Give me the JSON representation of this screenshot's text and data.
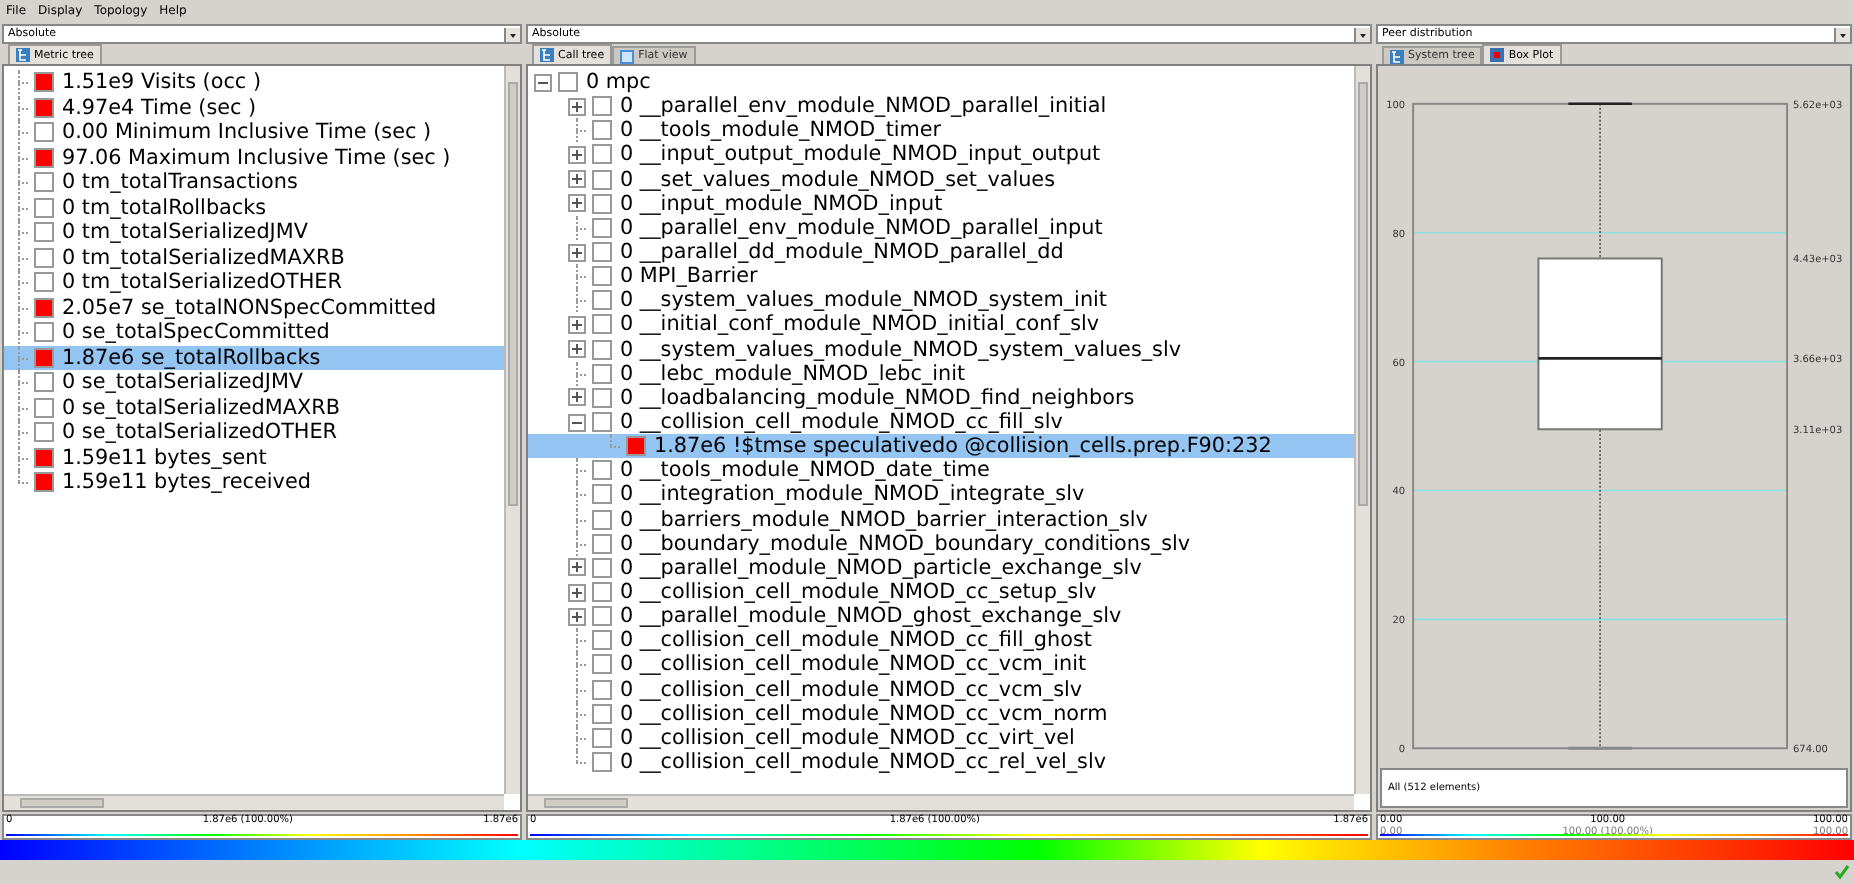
{
  "menu": [
    "File",
    "Display",
    "Topology",
    "Help"
  ],
  "metric_panel": {
    "mode": "Absolute",
    "tabs": [
      {
        "label": "Metric tree",
        "kind": "tree",
        "selected": true
      }
    ],
    "items": [
      {
        "label": "1.51e9 Visits (occ )",
        "color": "#ff0000",
        "selected": false
      },
      {
        "label": "4.97e4 Time (sec )",
        "color": "#ff0000",
        "selected": false
      },
      {
        "label": "0.00 Minimum Inclusive Time (sec )",
        "color": "#ffffff",
        "selected": false
      },
      {
        "label": "97.06 Maximum Inclusive Time (sec )",
        "color": "#ff0000",
        "selected": false
      },
      {
        "label": "0 tm_totalTransactions",
        "color": "#ffffff",
        "selected": false
      },
      {
        "label": "0 tm_totalRollbacks",
        "color": "#ffffff",
        "selected": false
      },
      {
        "label": "0 tm_totalSerializedJMV",
        "color": "#ffffff",
        "selected": false
      },
      {
        "label": "0 tm_totalSerializedMAXRB",
        "color": "#ffffff",
        "selected": false
      },
      {
        "label": "0 tm_totalSerializedOTHER",
        "color": "#ffffff",
        "selected": false
      },
      {
        "label": "2.05e7 se_totalNONSpecCommitted",
        "color": "#ff0000",
        "selected": false
      },
      {
        "label": "0 se_totalSpecCommitted",
        "color": "#ffffff",
        "selected": false
      },
      {
        "label": "1.87e6 se_totalRollbacks",
        "color": "#ff0000",
        "selected": true
      },
      {
        "label": "0 se_totalSerializedJMV",
        "color": "#ffffff",
        "selected": false
      },
      {
        "label": "0 se_totalSerializedMAXRB",
        "color": "#ffffff",
        "selected": false
      },
      {
        "label": "0 se_totalSerializedOTHER",
        "color": "#ffffff",
        "selected": false
      },
      {
        "label": "1.59e11 bytes_sent",
        "color": "#ff0000",
        "selected": false
      },
      {
        "label": "1.59e11 bytes_received",
        "color": "#ff0000",
        "selected": false
      }
    ],
    "scale": {
      "min": "0",
      "center": "1.87e6 (100.00%)",
      "max": "1.87e6"
    }
  },
  "call_panel": {
    "mode": "Absolute",
    "tabs": [
      {
        "label": "Call tree",
        "kind": "tree",
        "selected": true
      },
      {
        "label": "Flat view",
        "kind": "flat",
        "selected": false
      }
    ],
    "tree": [
      {
        "label": "0 mpc",
        "kind": "expanded",
        "color": "#ffffff",
        "selected": false,
        "children": [
          {
            "label": "0 __parallel_env_module_NMOD_parallel_initial",
            "kind": "collapsed",
            "color": "#ffffff",
            "selected": false
          },
          {
            "label": "0 __tools_module_NMOD_timer",
            "kind": "leaf",
            "color": "#ffffff",
            "selected": false
          },
          {
            "label": "0 __input_output_module_NMOD_input_output",
            "kind": "collapsed",
            "color": "#ffffff",
            "selected": false
          },
          {
            "label": "0 __set_values_module_NMOD_set_values",
            "kind": "collapsed",
            "color": "#ffffff",
            "selected": false
          },
          {
            "label": "0 __input_module_NMOD_input",
            "kind": "collapsed",
            "color": "#ffffff",
            "selected": false
          },
          {
            "label": "0 __parallel_env_module_NMOD_parallel_input",
            "kind": "leaf",
            "color": "#ffffff",
            "selected": false
          },
          {
            "label": "0 __parallel_dd_module_NMOD_parallel_dd",
            "kind": "collapsed",
            "color": "#ffffff",
            "selected": false
          },
          {
            "label": "0 MPI_Barrier",
            "kind": "leaf",
            "color": "#ffffff",
            "selected": false
          },
          {
            "label": "0 __system_values_module_NMOD_system_init",
            "kind": "leaf",
            "color": "#ffffff",
            "selected": false
          },
          {
            "label": "0 __initial_conf_module_NMOD_initial_conf_slv",
            "kind": "collapsed",
            "color": "#ffffff",
            "selected": false
          },
          {
            "label": "0 __system_values_module_NMOD_system_values_slv",
            "kind": "collapsed",
            "color": "#ffffff",
            "selected": false
          },
          {
            "label": "0 __lebc_module_NMOD_lebc_init",
            "kind": "leaf",
            "color": "#ffffff",
            "selected": false
          },
          {
            "label": "0 __loadbalancing_module_NMOD_find_neighbors",
            "kind": "collapsed",
            "color": "#ffffff",
            "selected": false
          },
          {
            "label": "0 __collision_cell_module_NMOD_cc_fill_slv",
            "kind": "expanded",
            "color": "#ffffff",
            "selected": false,
            "children": [
              {
                "label": "1.87e6 !$tmse speculativedo @collision_cells.prep.F90:232",
                "kind": "leaf",
                "color": "#ff0000",
                "selected": true
              }
            ]
          },
          {
            "label": "0 __tools_module_NMOD_date_time",
            "kind": "leaf",
            "color": "#ffffff",
            "selected": false
          },
          {
            "label": "0 __integration_module_NMOD_integrate_slv",
            "kind": "leaf",
            "color": "#ffffff",
            "selected": false
          },
          {
            "label": "0 __barriers_module_NMOD_barrier_interaction_slv",
            "kind": "leaf",
            "color": "#ffffff",
            "selected": false
          },
          {
            "label": "0 __boundary_module_NMOD_boundary_conditions_slv",
            "kind": "leaf",
            "color": "#ffffff",
            "selected": false
          },
          {
            "label": "0 __parallel_module_NMOD_particle_exchange_slv",
            "kind": "collapsed",
            "color": "#ffffff",
            "selected": false
          },
          {
            "label": "0 __collision_cell_module_NMOD_cc_setup_slv",
            "kind": "collapsed",
            "color": "#ffffff",
            "selected": false
          },
          {
            "label": "0 __parallel_module_NMOD_ghost_exchange_slv",
            "kind": "collapsed",
            "color": "#ffffff",
            "selected": false
          },
          {
            "label": "0 __collision_cell_module_NMOD_cc_fill_ghost",
            "kind": "leaf",
            "color": "#ffffff",
            "selected": false
          },
          {
            "label": "0 __collision_cell_module_NMOD_cc_vcm_init",
            "kind": "leaf",
            "color": "#ffffff",
            "selected": false
          },
          {
            "label": "0 __collision_cell_module_NMOD_cc_vcm_slv",
            "kind": "leaf",
            "color": "#ffffff",
            "selected": false
          },
          {
            "label": "0 __collision_cell_module_NMOD_cc_vcm_norm",
            "kind": "leaf",
            "color": "#ffffff",
            "selected": false
          },
          {
            "label": "0 __collision_cell_module_NMOD_cc_virt_vel",
            "kind": "leaf",
            "color": "#ffffff",
            "selected": false
          },
          {
            "label": "0 __collision_cell_module_NMOD_cc_rel_vel_slv",
            "kind": "leaf",
            "color": "#ffffff",
            "selected": false
          }
        ]
      }
    ],
    "scale": {
      "min": "0",
      "center": "1.87e6 (100.00%)",
      "max": "1.87e6"
    }
  },
  "system_panel": {
    "mode": "Peer distribution",
    "tabs": [
      {
        "label": "System tree",
        "kind": "tree",
        "selected": false
      },
      {
        "label": "Box Plot",
        "kind": "plot",
        "selected": true
      }
    ],
    "box_plot": {
      "y_ticks": [
        "100",
        "80",
        "60",
        "40",
        "20",
        "0"
      ],
      "value_labels": [
        "5.62e+03",
        "4.43e+03",
        "3.66e+03",
        "3.11e+03",
        "674.00"
      ]
    },
    "selection": "All (512 elements)",
    "scale": {
      "min": "0.00",
      "center": "100.00",
      "max": "100.00",
      "sub_min": "0.00",
      "sub_center": "100.00 (100.00%)",
      "sub_max": "100.00"
    }
  }
}
